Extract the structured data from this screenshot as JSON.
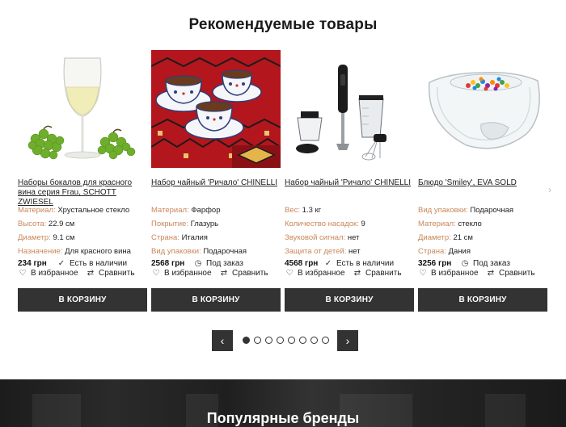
{
  "section_title": "Рекомендуемые товары",
  "products": [
    {
      "title": "Наборы бокалов для красного вина серия Frau, SCHOTT ZWIESEL",
      "image": "wine-glass-grapes-image",
      "specs": [
        {
          "k": "Материал:",
          "v": "Хрустальное стекло"
        },
        {
          "k": "Высота:",
          "v": "22.9 см"
        },
        {
          "k": "Диаметр:",
          "v": "9.1 см"
        },
        {
          "k": "Назначение:",
          "v": "Для красного вина"
        }
      ],
      "price": "234 грн",
      "stock": "Есть в наличии",
      "stock_icon": "check-icon",
      "favorite": "В избранное",
      "compare": "Сравнить",
      "cart": "В корзину"
    },
    {
      "title": "Набор чайный 'Ричало' CHINELLI",
      "image": "tea-set-on-rug-image",
      "specs": [
        {
          "k": "Материал:",
          "v": "Фарфор"
        },
        {
          "k": "Покрытие:",
          "v": "Глазурь"
        },
        {
          "k": "Страна:",
          "v": "Италия"
        },
        {
          "k": "Вид упаковки:",
          "v": "Подарочная"
        }
      ],
      "price": "2568 грн",
      "stock": "Под заказ",
      "stock_icon": "clock-icon",
      "favorite": "В избранное",
      "compare": "Сравнить",
      "cart": "В корзину"
    },
    {
      "title": "Набор чайный 'Ричало' CHINELLI",
      "image": "hand-blender-set-image",
      "specs": [
        {
          "k": "Вес:",
          "v": "1.3 кг"
        },
        {
          "k": "Количество насадок:",
          "v": "9"
        },
        {
          "k": "Звуковой сигнал:",
          "v": "нет"
        },
        {
          "k": "Защита от детей:",
          "v": "нет"
        }
      ],
      "price": "4568 грн",
      "stock": "Есть в наличии",
      "stock_icon": "check-icon",
      "favorite": "В избранное",
      "compare": "Сравнить",
      "cart": "В корзину"
    },
    {
      "title": "Блюдо 'Smiley', EVA SOLD",
      "image": "glass-bowl-candies-image",
      "specs": [
        {
          "k": "Вид упаковки:",
          "v": "Подарочная"
        },
        {
          "k": "Материал:",
          "v": "стекло"
        },
        {
          "k": "Диаметр:",
          "v": "21 см"
        },
        {
          "k": "Страна:",
          "v": "Дания"
        }
      ],
      "price": "3256 грн",
      "stock": "Под заказ",
      "stock_icon": "clock-icon",
      "favorite": "В избранное",
      "compare": "Сравнить",
      "cart": "В корзину"
    }
  ],
  "pager": {
    "prev_icon": "chevron-left-icon",
    "next_icon": "chevron-right-icon",
    "prev": "‹",
    "next": "›",
    "dot_count": 8,
    "active_index": 0
  },
  "next_edge_arrow": "›",
  "brands_title": "Популярные бренды",
  "colors": {
    "spec_key": "#c8875a",
    "button_bg": "#333333",
    "button_text": "#ffffff"
  }
}
